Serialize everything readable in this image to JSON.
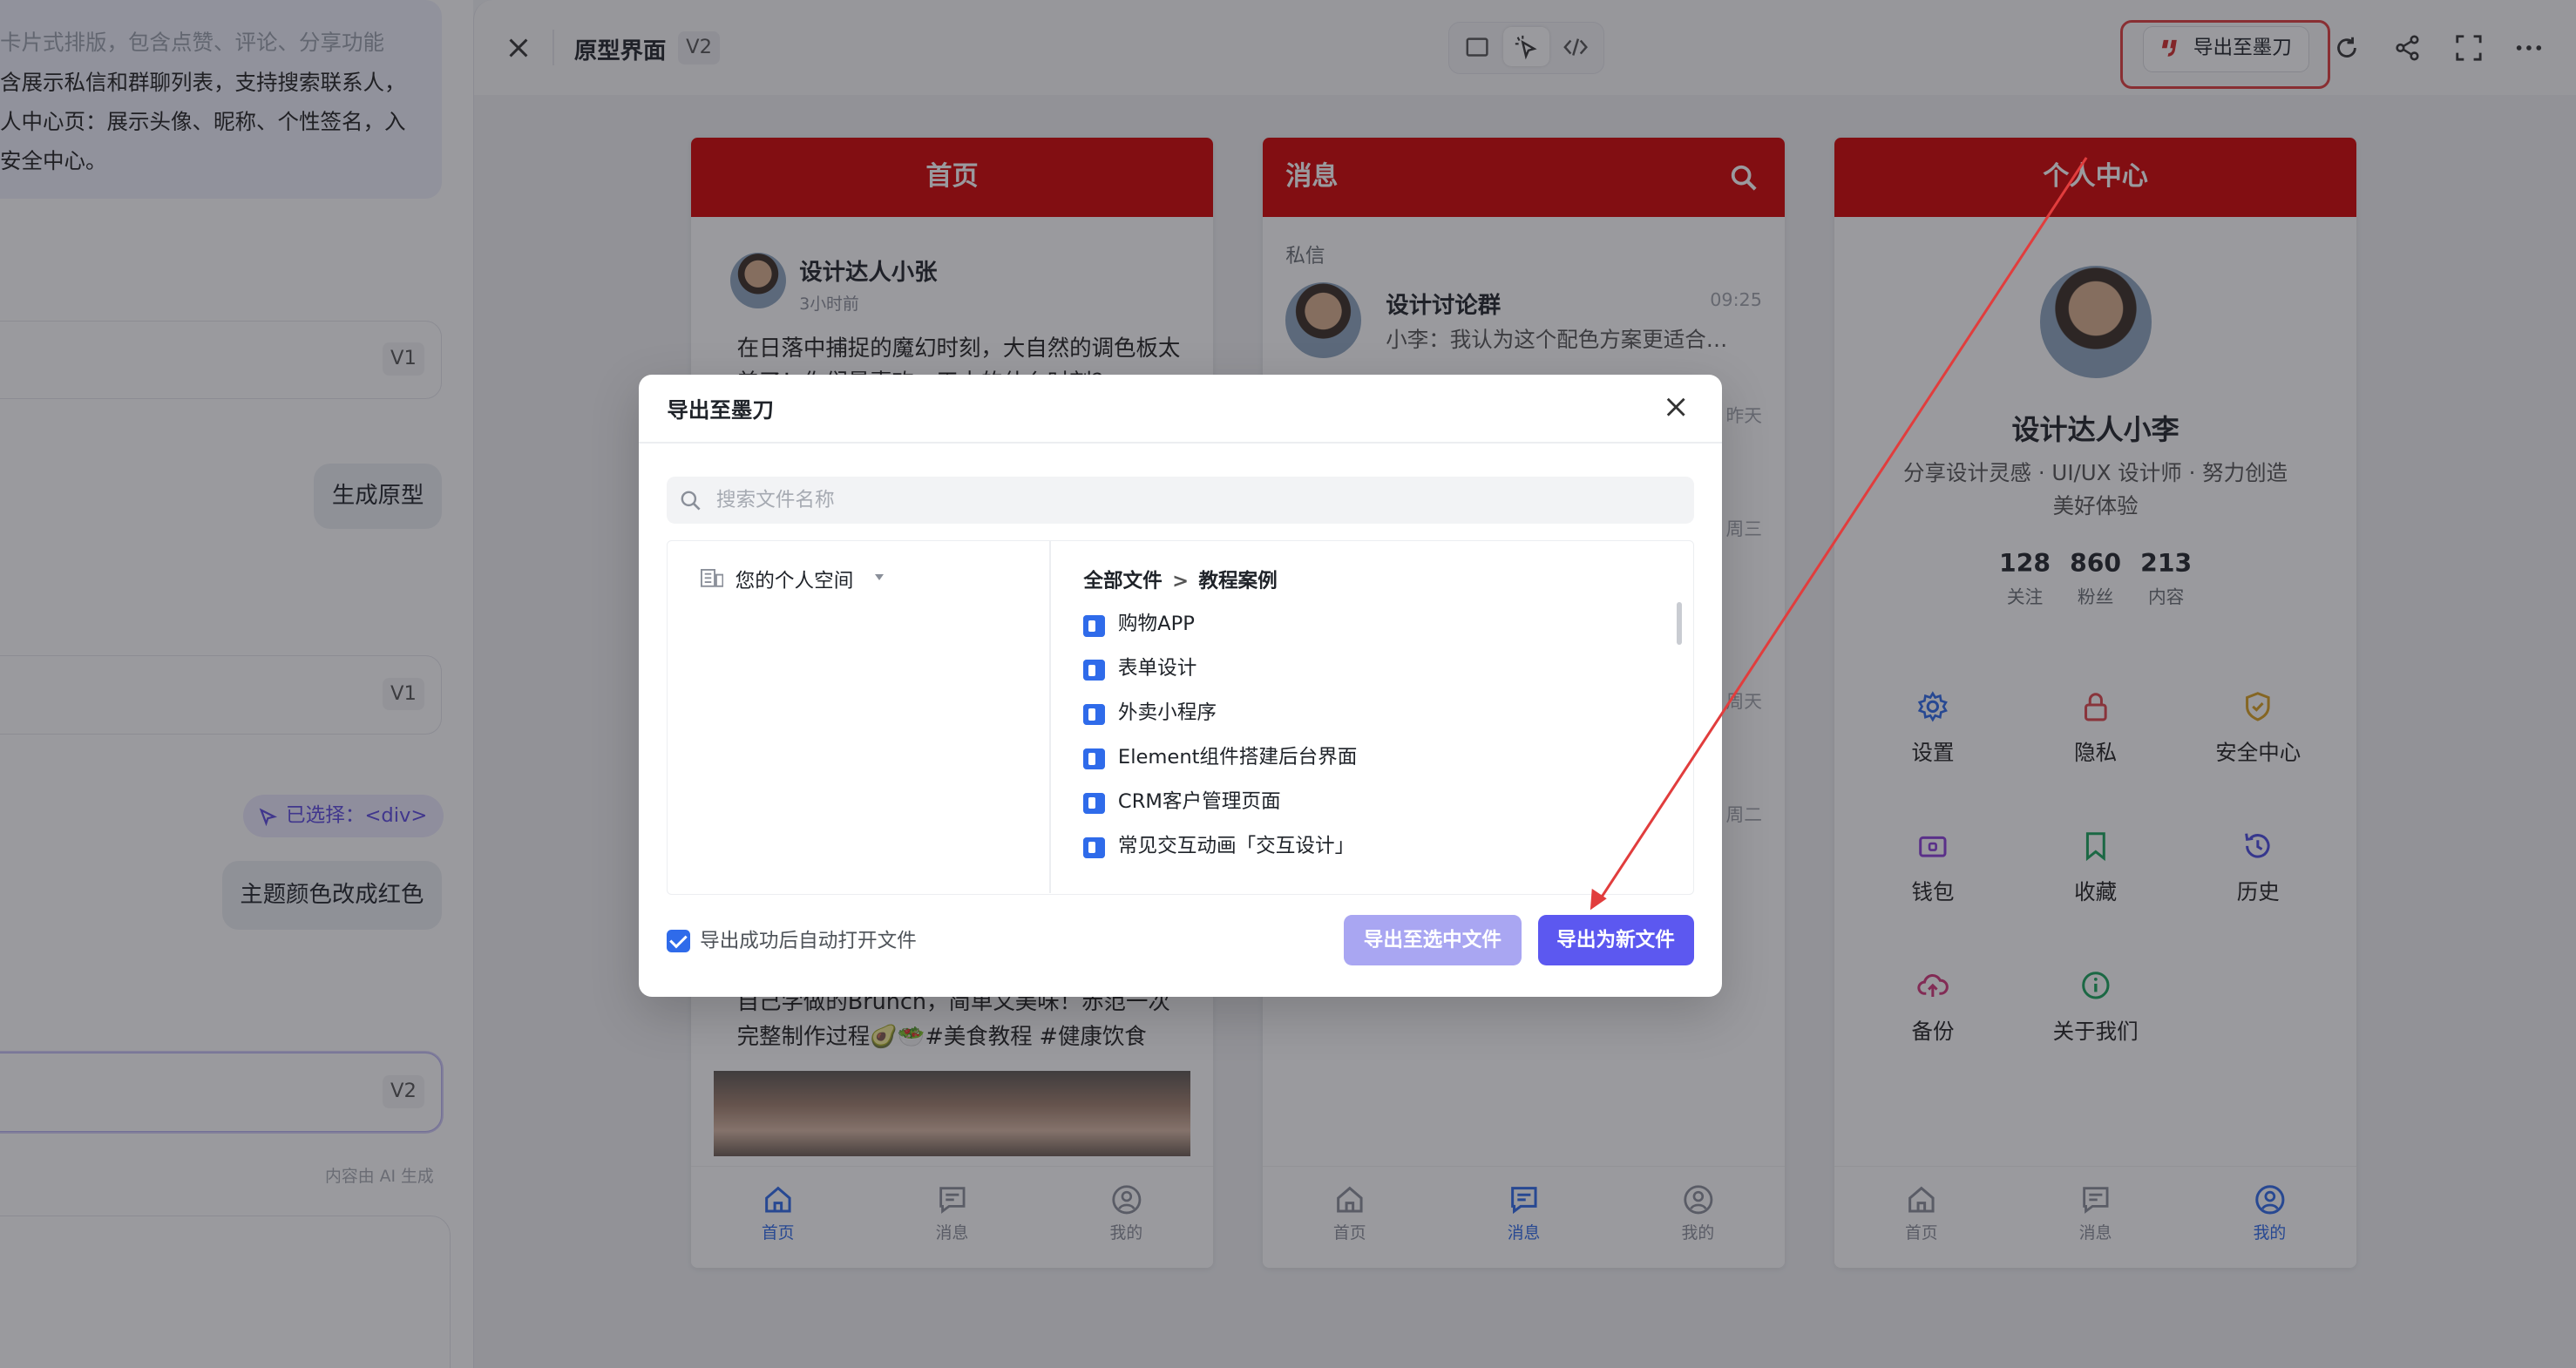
{
  "left_pane": {
    "bubble_lines": [
      "卡片式排版，包含点赞、评论、分享功能",
      "含展示私信和群聊列表，支持搜索联系人，",
      "人中心页：展示头像、昵称、个性签名，入",
      "安全中心。"
    ],
    "version_cards": [
      "V1",
      "V1",
      "V2"
    ],
    "user_msg_1": "生成原型",
    "selected_chip": "已选择：<div>",
    "user_msg_2": "主题颜色改成红色",
    "ai_note": "内容由 AI 生成"
  },
  "topbar": {
    "title": "原型界面",
    "version": "V2",
    "export_label": "导出至墨刀"
  },
  "phones": {
    "home": {
      "title": "首页",
      "post1_name": "设计达人小张",
      "post1_time": "3小时前",
      "post1_text": "在日落中捕捉的魔幻时刻，大自然的调色板太美了！你们最喜欢一天中的什么时刻？",
      "post2_text": "自己学做的Brunch，简单又美味！赤范一次完整制作过程🥑🥗#美食教程 #健康饮食",
      "nav": [
        "首页",
        "消息",
        "我的"
      ]
    },
    "messages": {
      "title": "消息",
      "section_label": "私信",
      "row1_name": "设计讨论群",
      "row1_time": "09:25",
      "row1_preview": "小李：我认为这个配色方案更适合…",
      "row_times": [
        "昨天",
        "周三",
        "周天",
        "周二"
      ],
      "nav": [
        "首页",
        "消息",
        "我的"
      ]
    },
    "profile": {
      "title": "个人中心",
      "name": "设计达人小李",
      "bio": "分享设计灵感 · UI/UX 设计师 · 努力创造美好体验",
      "stats": [
        {
          "value": "128",
          "label": "关注"
        },
        {
          "value": "860",
          "label": "粉丝"
        },
        {
          "value": "213",
          "label": "内容"
        }
      ],
      "menu": [
        "设置",
        "隐私",
        "安全中心",
        "钱包",
        "收藏",
        "历史",
        "备份",
        "关于我们"
      ],
      "nav": [
        "首页",
        "消息",
        "我的"
      ]
    }
  },
  "dialog": {
    "title": "导出至墨刀",
    "search_placeholder": "搜索文件名称",
    "space_label": "您的个人空间",
    "breadcrumb_root": "全部文件",
    "breadcrumb_sep": ">",
    "breadcrumb_current": "教程案例",
    "files": [
      "购物APP",
      "表单设计",
      "外卖小程序",
      "Element组件搭建后台界面",
      "CRM客户管理页面",
      "常见交互动画「交互设计」"
    ],
    "auto_open_label": "导出成功后自动打开文件",
    "auto_open_checked": true,
    "btn_export_selected": "导出至选中文件",
    "btn_export_new": "导出为新文件"
  },
  "colors": {
    "theme_red": "#d40000",
    "primary": "#5c58f0",
    "annotation_red": "#e13d3d"
  }
}
